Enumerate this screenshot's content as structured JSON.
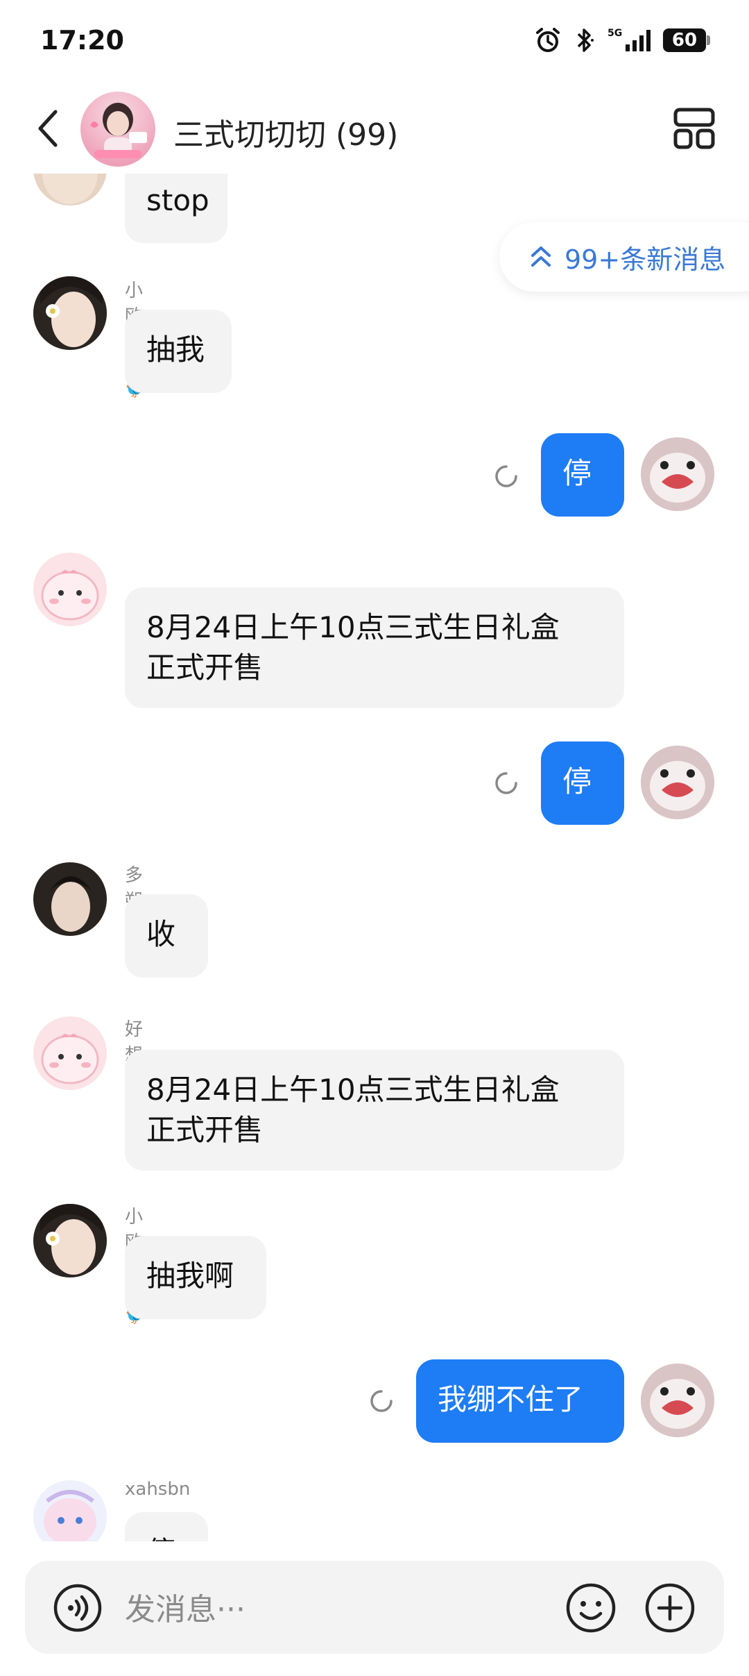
{
  "status_bar": {
    "time": "17:20",
    "network": "5G",
    "battery": "60",
    "icons": [
      "alarm-icon",
      "bluetooth-icon",
      "signal-icon",
      "battery-icon"
    ]
  },
  "header": {
    "title": "三式切切切 (99)",
    "back_icon": "back-icon",
    "menu_icon": "layout-icon"
  },
  "new_messages": {
    "label": "99+条新消息",
    "icon": "double-chevron-up-icon"
  },
  "messages": [
    {
      "sender": "",
      "text": "stop",
      "mine": false
    },
    {
      "sender": "小欧不叽🐦",
      "text": "抽我",
      "mine": false
    },
    {
      "sender": "",
      "text": "停",
      "mine": true
    },
    {
      "sender": "",
      "text": "8月24日上午10点三式生日礼盒\n正式开售",
      "mine": false
    },
    {
      "sender": "",
      "text": "停",
      "mine": true
    },
    {
      "sender": "多朔一点",
      "text": "收",
      "mine": false
    },
    {
      "sender": "好想吃鱼丸",
      "text": "8月24日上午10点三式生日礼盒\n正式开售",
      "mine": false
    },
    {
      "sender": "小欧不叽🐦",
      "text": "抽我啊",
      "mine": false
    },
    {
      "sender": "",
      "text": "我绷不住了",
      "mine": true
    },
    {
      "sender": "xahsbn",
      "text": "停",
      "mine": false
    }
  ],
  "input": {
    "placeholder": "发消息···",
    "voice_icon": "voice-icon",
    "emoji_icon": "emoji-icon",
    "plus_icon": "plus-icon"
  },
  "colors": {
    "accent": "#1e7cf5",
    "bubble_other": "#f3f3f3",
    "link_blue": "#3a78d6"
  }
}
